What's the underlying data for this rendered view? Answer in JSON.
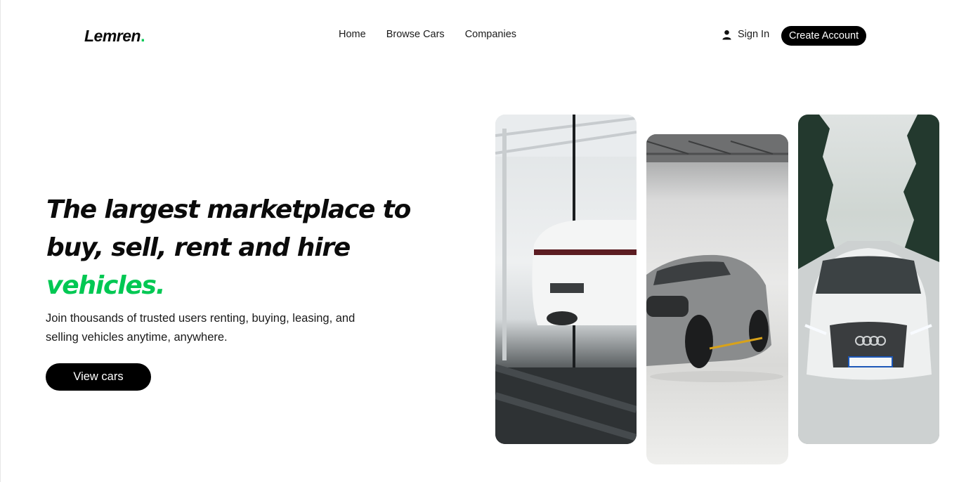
{
  "brand": {
    "name": "Lemren",
    "dot": ".",
    "accent_color": "#00c853"
  },
  "nav": {
    "items": [
      {
        "label": "Home"
      },
      {
        "label": "Browse Cars"
      },
      {
        "label": "Companies"
      }
    ]
  },
  "auth": {
    "sign_in_label": "Sign In",
    "sign_in_icon": "user-icon",
    "create_account_label": "Create Account"
  },
  "hero": {
    "title_line1": "The largest marketplace to",
    "title_line2": "buy, sell, rent and hire",
    "title_accent": "vehicles.",
    "subtitle_line1": "Join thousands of trusted users renting, buying, leasing, and",
    "subtitle_line2": "selling vehicles anytime, anywhere.",
    "cta_label": "View cars"
  },
  "gallery": {
    "images": [
      {
        "name": "white-suv-rear-in-garage"
      },
      {
        "name": "grey-sports-car-in-studio"
      },
      {
        "name": "white-suv-front-on-snowy-road"
      }
    ]
  },
  "colors": {
    "primary": "#000000",
    "accent": "#00c853",
    "background": "#ffffff"
  }
}
